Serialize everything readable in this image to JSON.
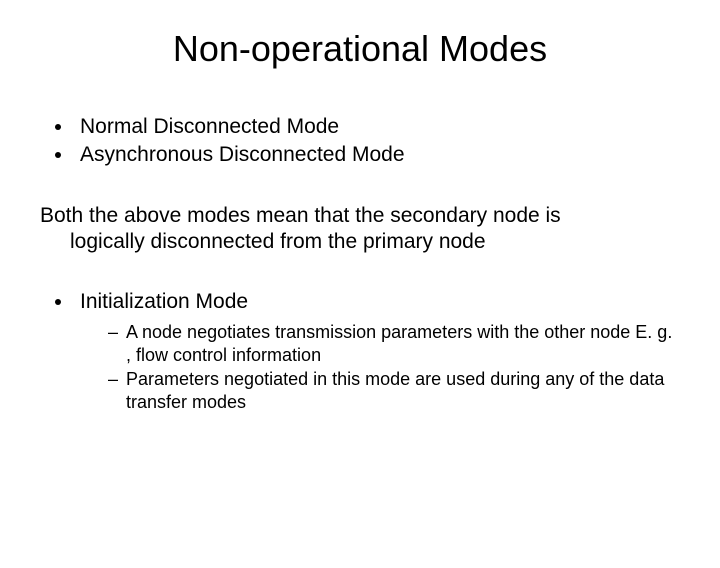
{
  "title": "Non-operational Modes",
  "bullets_top": [
    "Normal Disconnected Mode",
    "Asynchronous Disconnected Mode"
  ],
  "paragraph_line1": "Both the above modes mean that the secondary node is",
  "paragraph_line2": "logically disconnected from the primary node",
  "bullet_second": "Initialization Mode",
  "sub_bullets": [
    "A node negotiates transmission parameters with the other node E. g. , flow control information",
    "Parameters negotiated in this mode are used during any of the data transfer modes"
  ]
}
